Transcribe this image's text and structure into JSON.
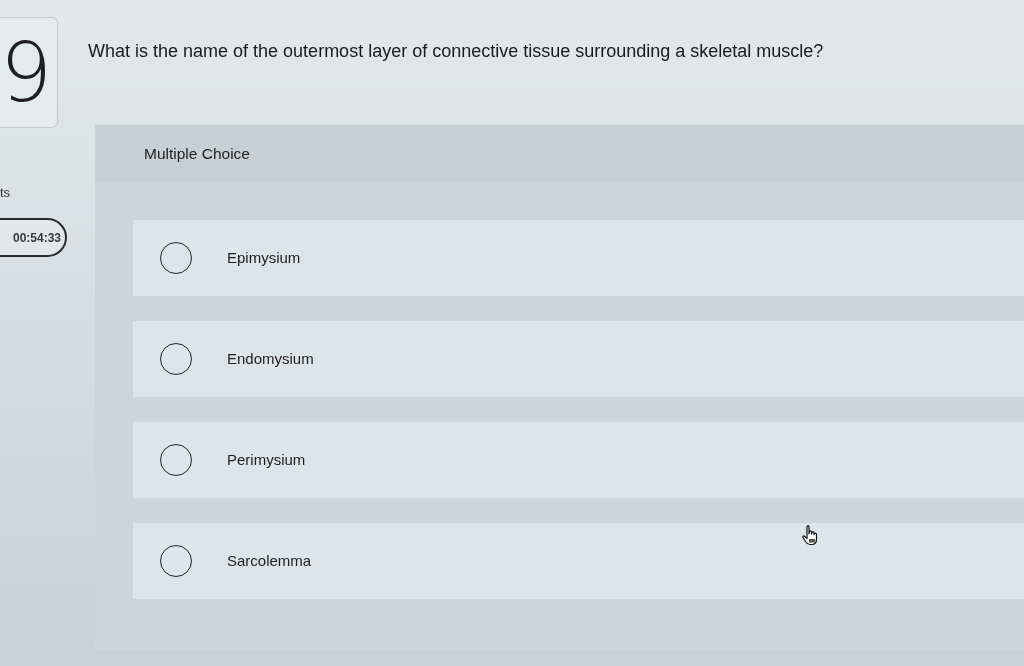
{
  "question_number": "9",
  "sidebar_label": "ts",
  "timer": "00:54:33",
  "question": "What is the name of the outermost layer of connective tissue surrounding a skeletal muscle?",
  "answer_panel": {
    "type_label": "Multiple Choice",
    "options": [
      {
        "label": "Epimysium",
        "selected": false
      },
      {
        "label": "Endomysium",
        "selected": false
      },
      {
        "label": "Perimysium",
        "selected": false
      },
      {
        "label": "Sarcolemma",
        "selected": false
      }
    ]
  }
}
